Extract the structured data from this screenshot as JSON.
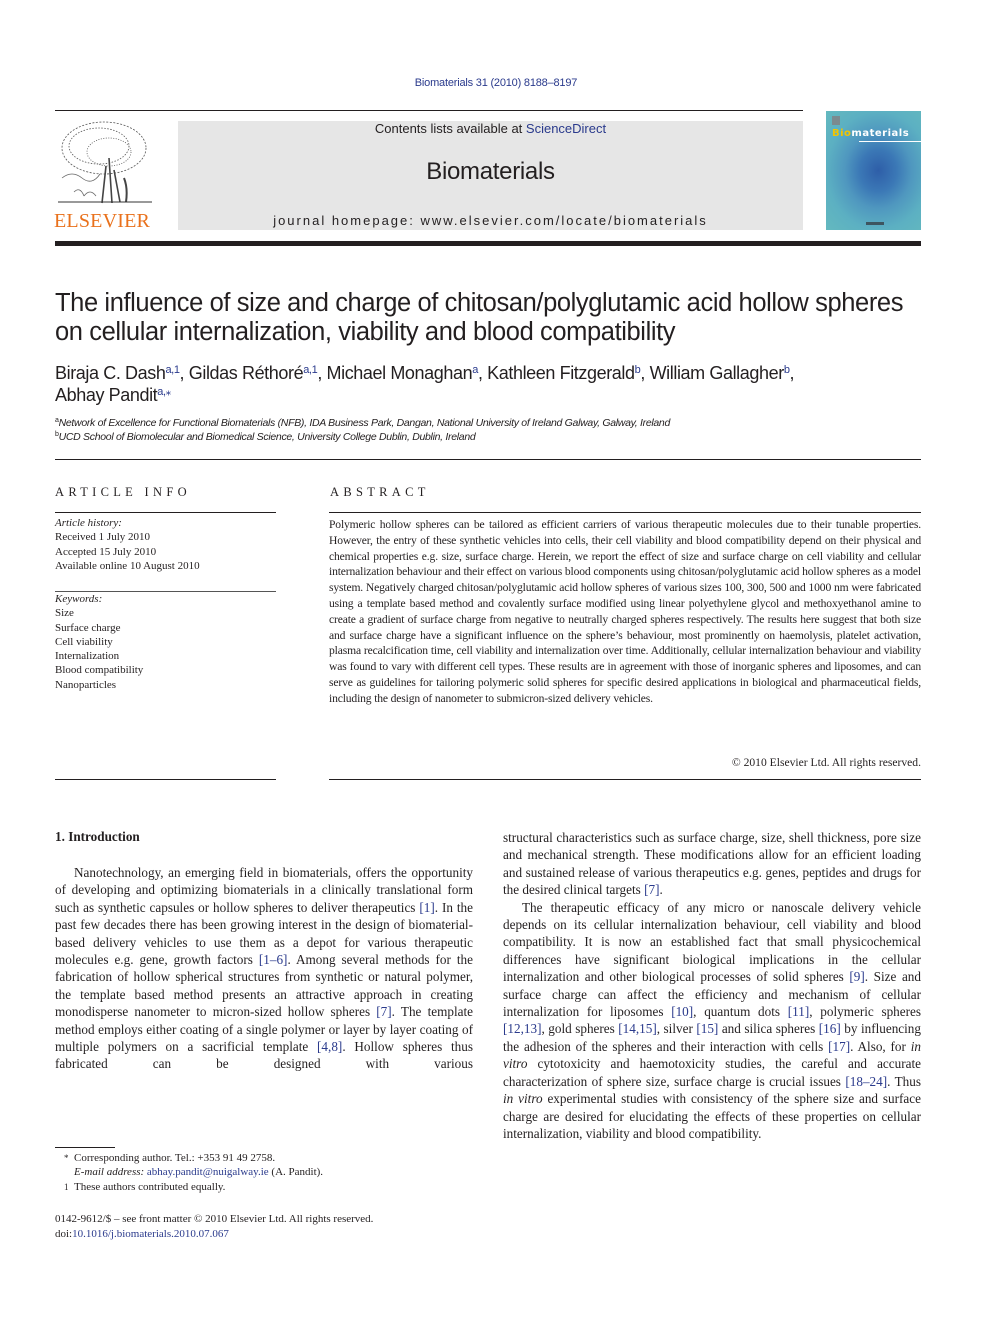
{
  "citation": "Biomaterials 31 (2010) 8188–8197",
  "header": {
    "publisher_logo_icon": "elsevier-tree-logo",
    "publisher_wordmark": "ELSEVIER",
    "contents_prefix": "Contents lists available at ",
    "contents_link": "ScienceDirect",
    "journal_name": "Biomaterials",
    "homepage": "journal homepage: www.elsevier.com/locate/biomaterials",
    "cover": {
      "title_accent": "Bio",
      "title_rest": "materials",
      "icon": "journal-cover-image"
    }
  },
  "colors": {
    "link": "#2a3a8c",
    "elsevier_orange": "#e9711c",
    "banner_bg": "#e6e6e6",
    "cover_teal": "#5cb0c2",
    "cover_accent": "#f2c400"
  },
  "article": {
    "title_lines": [
      "The influence of size and charge of chitosan/polyglutamic acid hollow spheres",
      "on cellular internalization, viability and blood compatibility"
    ],
    "authors": [
      {
        "name": "Biraja C. Dash",
        "sup": "a,1",
        "sep": ", "
      },
      {
        "name": "Gildas Réthoré",
        "sup": "a,1",
        "sep": ", "
      },
      {
        "name": "Michael Monaghan",
        "sup": "a",
        "sep": ", "
      },
      {
        "name": "Kathleen Fitzgerald",
        "sup": "b",
        "sep": ", "
      },
      {
        "name": "William Gallagher",
        "sup": "b",
        "sep": ","
      },
      {
        "name": "Abhay Pandit",
        "sup": "a,⁎",
        "sep": ""
      }
    ],
    "affiliations": [
      {
        "mark": "a",
        "text": "Network of Excellence for Functional Biomaterials (NFB), IDA Business Park, Dangan, National University of Ireland Galway, Galway, Ireland"
      },
      {
        "mark": "b",
        "text": "UCD School of Biomolecular and Biomedical Science, University College Dublin, Dublin, Ireland"
      }
    ]
  },
  "article_info": {
    "heading": "ARTICLE INFO",
    "history_label": "Article history:",
    "history": [
      "Received 1 July 2010",
      "Accepted 15 July 2010",
      "Available online 10 August 2010"
    ],
    "keywords_label": "Keywords:",
    "keywords": [
      "Size",
      "Surface charge",
      "Cell viability",
      "Internalization",
      "Blood compatibility",
      "Nanoparticles"
    ]
  },
  "abstract": {
    "heading": "ABSTRACT",
    "text": "Polymeric hollow spheres can be tailored as efficient carriers of various therapeutic molecules due to their tunable properties. However, the entry of these synthetic vehicles into cells, their cell viability and blood compatibility depend on their physical and chemical properties e.g. size, surface charge. Herein, we report the effect of size and surface charge on cell viability and cellular internalization behaviour and their effect on various blood components using chitosan/polyglutamic acid hollow spheres as a model system. Negatively charged chitosan/polyglutamic acid hollow spheres of various sizes 100, 300, 500 and 1000 nm were fabricated using a template based method and covalently surface modified using linear polyethylene glycol and methoxyethanol amine to create a gradient of surface charge from negative to neutrally charged spheres respectively. The results here suggest that both size and surface charge have a significant influence on the sphere’s behaviour, most prominently on haemolysis, platelet activation, plasma recalcification time, cell viability and internalization over time. Additionally, cellular internali­zation behaviour and viability was found to vary with different cell types. These results are in agreement with those of inorganic spheres and liposomes, and can serve as guidelines for tailoring polymeric solid spheres for specific desired applications in biological and pharmaceutical fields, including the design of nanometer to submicron-sized delivery vehicles.",
    "copyright": "© 2010 Elsevier Ltd. All rights reserved."
  },
  "body": {
    "section_heading": "1.  Introduction",
    "paragraph1": [
      {
        "t": "Nanotechnology, an emerging field in biomaterials, offers the opportunity of developing and optimizing biomaterials in a clinically translational form such as synthetic capsules or hollow spheres to deliver therapeutics "
      },
      {
        "ref": "[1]"
      },
      {
        "t": ". In the past few decades there has been growing interest in the design of biomaterial-based delivery vehicles to use them as a depot for various therapeutic molecules e.g. gene, growth factors "
      },
      {
        "ref": "[1–6]"
      },
      {
        "t": ". Among several methods for the fabrication of hollow spherical structures from synthetic or natural polymer, the template based method presents an attractive approach in creating monodisperse nanometer to micron-sized hollow spheres "
      },
      {
        "ref": "[7]"
      },
      {
        "t": ". The template method employs either coating of a single polymer or layer by layer coating of multiple polymers on a sacrificial template "
      },
      {
        "ref": "[4,8]"
      },
      {
        "t": ". Hollow spheres thus fabricated can be designed with various structural characteristics such as surface charge, size, shell thickness, pore size and mechanical strength. These modifications allow for an efficient loading and sustained release of various therapeutics e.g. genes, peptides and drugs for the desired clinical targets "
      },
      {
        "ref": "[7]"
      },
      {
        "t": "."
      }
    ],
    "paragraph2": [
      {
        "t": "The therapeutic efficacy of any micro or nanoscale delivery vehicle depends on its cellular internalization behaviour, cell viability and blood compatibility. It is now an established fact that small physicochemical differences have significant biological implications in the cellular internalization and other biological processes of solid spheres "
      },
      {
        "ref": "[9]"
      },
      {
        "t": ". Size and surface charge can affect the efficiency and mechanism of cellular internalization for liposomes "
      },
      {
        "ref": "[10]"
      },
      {
        "t": ", quantum dots "
      },
      {
        "ref": "[11]"
      },
      {
        "t": ", polymeric spheres "
      },
      {
        "ref": "[12,13]"
      },
      {
        "t": ", gold spheres "
      },
      {
        "ref": "[14,15]"
      },
      {
        "t": ", silver "
      },
      {
        "ref": "[15]"
      },
      {
        "t": " and silica spheres "
      },
      {
        "ref": "[16]"
      },
      {
        "t": " by influencing the adhesion of the spheres and their interaction with cells "
      },
      {
        "ref": "[17]"
      },
      {
        "t": ". Also, for "
      },
      {
        "i": "in vitro"
      },
      {
        "t": " cytotoxicity and haemotoxicity studies, the careful and accurate characterization of sphere size, surface charge is crucial issues "
      },
      {
        "ref": "[18–24]"
      },
      {
        "t": ". Thus "
      },
      {
        "i": "in vitro"
      },
      {
        "t": " experimental studies with consistency of the sphere size and surface charge are desired for elucidating the effects of these properties on cellular internalization, viability and blood compatibility."
      }
    ]
  },
  "footnotes": {
    "corresponding_mark": "*",
    "corresponding": "Corresponding author. Tel.: +353 91 49 2758.",
    "email_label": "E-mail address: ",
    "email": "abhay.pandit@nuigalway.ie",
    "email_suffix": " (A. Pandit).",
    "equal_mark": "1",
    "equal": "These authors contributed equally."
  },
  "front_matter": {
    "issn": "0142-9612/$ – see front matter © 2010 Elsevier Ltd. All rights reserved.",
    "doi_prefix": "doi:",
    "doi": "10.1016/j.biomaterials.2010.07.067"
  }
}
